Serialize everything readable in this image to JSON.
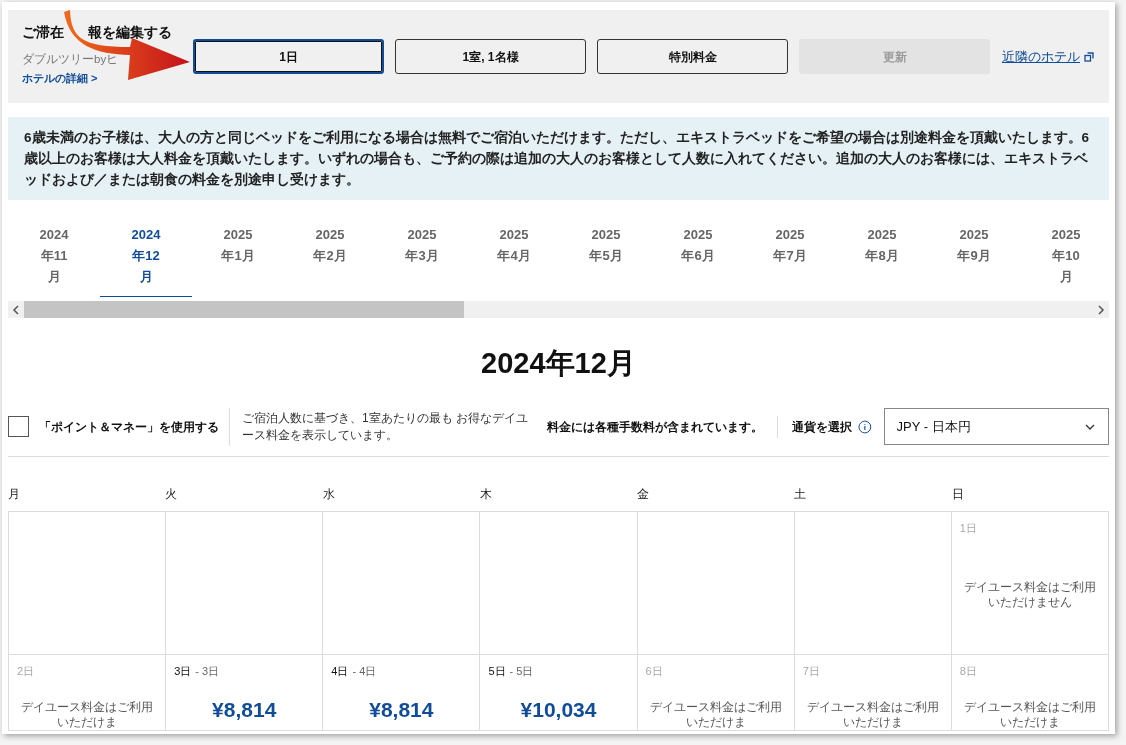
{
  "header": {
    "title_parts": [
      "ご滞在",
      "報を編集する"
    ],
    "subtitle": "ダブルツリーbyヒ",
    "details_link": "ホテルの詳細 >",
    "fields": [
      {
        "label": "1日",
        "selected": true
      },
      {
        "label": "1室, 1名様",
        "selected": false
      },
      {
        "label": "特別料金",
        "selected": false
      }
    ],
    "update_button": {
      "label": "更新",
      "disabled": true
    },
    "nearby_link": "近隣のホテル"
  },
  "notice": "6歳未満のお子様は、大人の方と同じベッドをご利用になる場合は無料でご宿泊いただけます。ただし、エキストラベッドをご希望の場合は別途料金を頂戴いたします。6歳以上のお客様は大人料金を頂戴いたします。いずれの場合も、ご予約の際は追加の大人のお客様として人数に入れてください。追加の大人のお客様には、エキストラベッドおよび／または朝食の料金を別途申し受けます。",
  "month_tabs": [
    {
      "label": "2024年11月",
      "selected": false
    },
    {
      "label": "2024年12月",
      "selected": true
    },
    {
      "label": "2025年1月",
      "selected": false
    },
    {
      "label": "2025年2月",
      "selected": false
    },
    {
      "label": "2025年3月",
      "selected": false
    },
    {
      "label": "2025年4月",
      "selected": false
    },
    {
      "label": "2025年5月",
      "selected": false
    },
    {
      "label": "2025年6月",
      "selected": false
    },
    {
      "label": "2025年7月",
      "selected": false
    },
    {
      "label": "2025年8月",
      "selected": false
    },
    {
      "label": "2025年9月",
      "selected": false
    },
    {
      "label": "2025年10月",
      "selected": false
    }
  ],
  "month_title": "2024年12月",
  "options": {
    "points_checkbox": {
      "label": "「ポイント＆マネー」を使用する",
      "checked": false
    },
    "rate_note": "ご宿泊人数に基づき、1室あたりの最も お得なデイユース料金を表示しています。",
    "fee_note": "料金には各種手数料が含まれています。",
    "currency_label": "通貨を選択",
    "currency_value": "JPY - 日本円"
  },
  "weekdays": [
    "月",
    "火",
    "水",
    "木",
    "金",
    "土",
    "日"
  ],
  "weeks": [
    [
      {
        "kind": "empty"
      },
      {
        "kind": "empty"
      },
      {
        "kind": "empty"
      },
      {
        "kind": "empty"
      },
      {
        "kind": "empty"
      },
      {
        "kind": "empty"
      },
      {
        "kind": "unavailable",
        "date": "1日",
        "note": "デイユース料金はご利用いただけません"
      }
    ],
    [
      {
        "kind": "unavailable",
        "date": "2日",
        "note": "デイユース料金はご利用いただけま"
      },
      {
        "kind": "price",
        "date": "3日",
        "end_date": "- 3日",
        "price": "¥8,814"
      },
      {
        "kind": "price",
        "date": "4日",
        "end_date": "- 4日",
        "price": "¥8,814"
      },
      {
        "kind": "price",
        "date": "5日",
        "end_date": "- 5日",
        "price": "¥10,034"
      },
      {
        "kind": "unavailable",
        "date": "6日",
        "note": "デイユース料金はご利用いただけま"
      },
      {
        "kind": "unavailable",
        "date": "7日",
        "note": "デイユース料金はご利用いただけま"
      },
      {
        "kind": "unavailable",
        "date": "8日",
        "note": "デイユース料金はご利用いただけま"
      }
    ]
  ]
}
